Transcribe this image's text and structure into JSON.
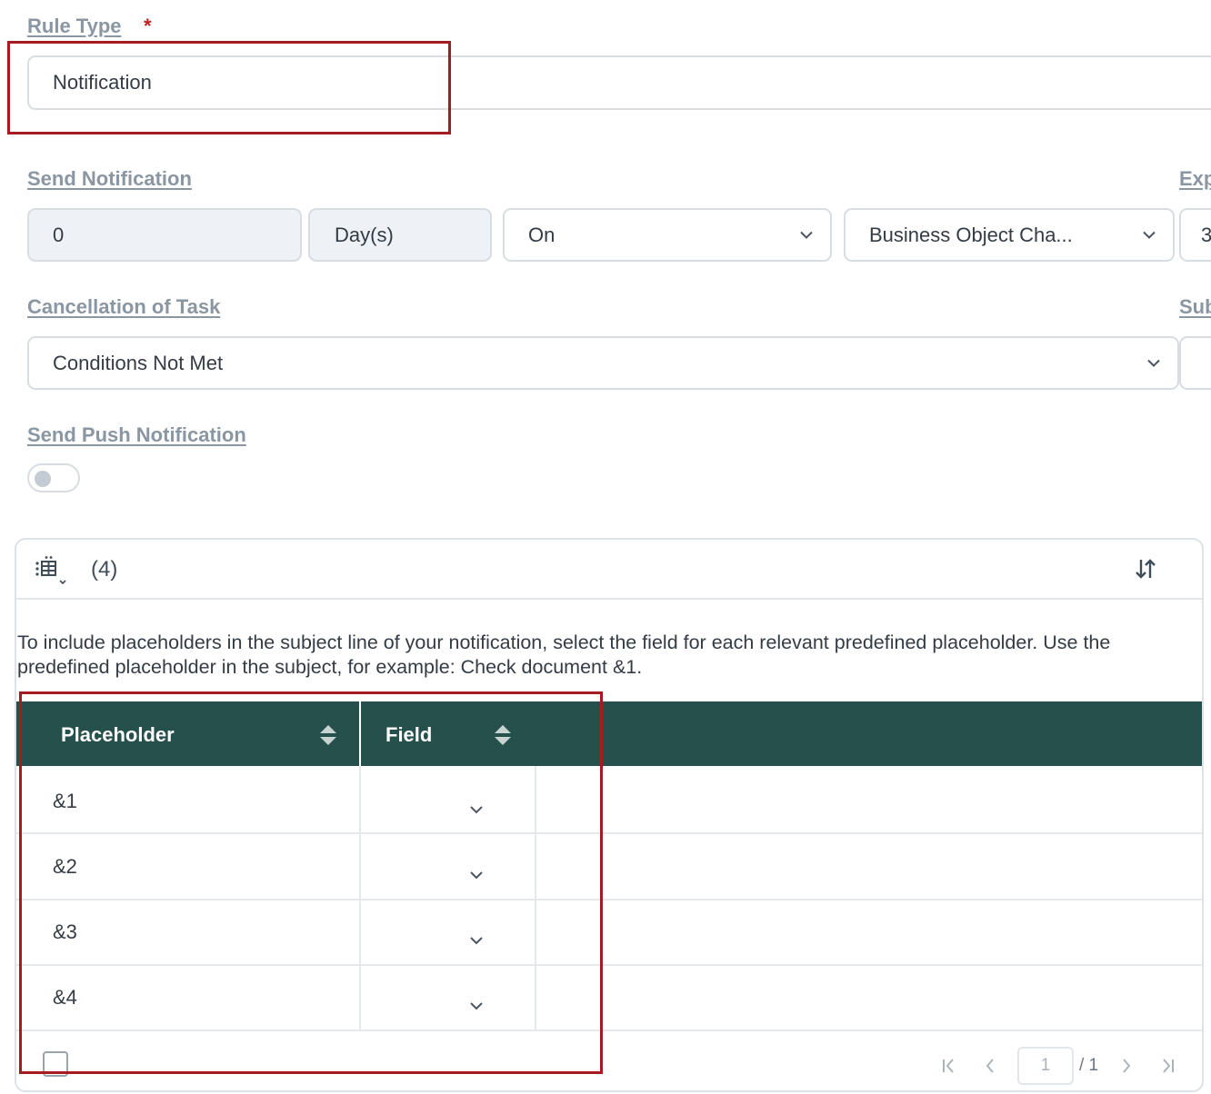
{
  "rule_type": {
    "label": "Rule Type",
    "required_mark": "*",
    "value": "Notification"
  },
  "send_notification": {
    "label": "Send Notification",
    "amount": "0",
    "unit": "Day(s)",
    "timing": "On",
    "event": "Business Object Cha...",
    "right_label_partial": "Exp",
    "right_field_partial": "3"
  },
  "cancellation": {
    "label": "Cancellation of Task",
    "value": "Conditions Not Met",
    "right_label_partial": "Sub"
  },
  "push": {
    "label": "Send Push Notification",
    "enabled": false
  },
  "table": {
    "count": "(4)",
    "description": "To include placeholders in the subject line of your notification, select the field for each relevant predefined placeholder. Use the predefined placeholder in the subject, for example: Check document &1.",
    "columns": [
      "Placeholder",
      "Field"
    ],
    "rows": [
      {
        "placeholder": "&1",
        "field": ""
      },
      {
        "placeholder": "&2",
        "field": ""
      },
      {
        "placeholder": "&3",
        "field": ""
      },
      {
        "placeholder": "&4",
        "field": ""
      }
    ],
    "pagination": {
      "page": "1",
      "total": "/ 1"
    }
  },
  "icons": {
    "table_settings": "table-settings-icon",
    "sort": "sort-icon",
    "dropdown": "chevron-down-icon",
    "column_sort": "sort-updown-icon",
    "first_page": "first-page-icon",
    "prev_page": "prev-page-icon",
    "next_page": "next-page-icon",
    "last_page": "last-page-icon"
  },
  "colors": {
    "header_bg": "#26504b",
    "highlight": "#a71a1f",
    "required": "#c0231e"
  }
}
